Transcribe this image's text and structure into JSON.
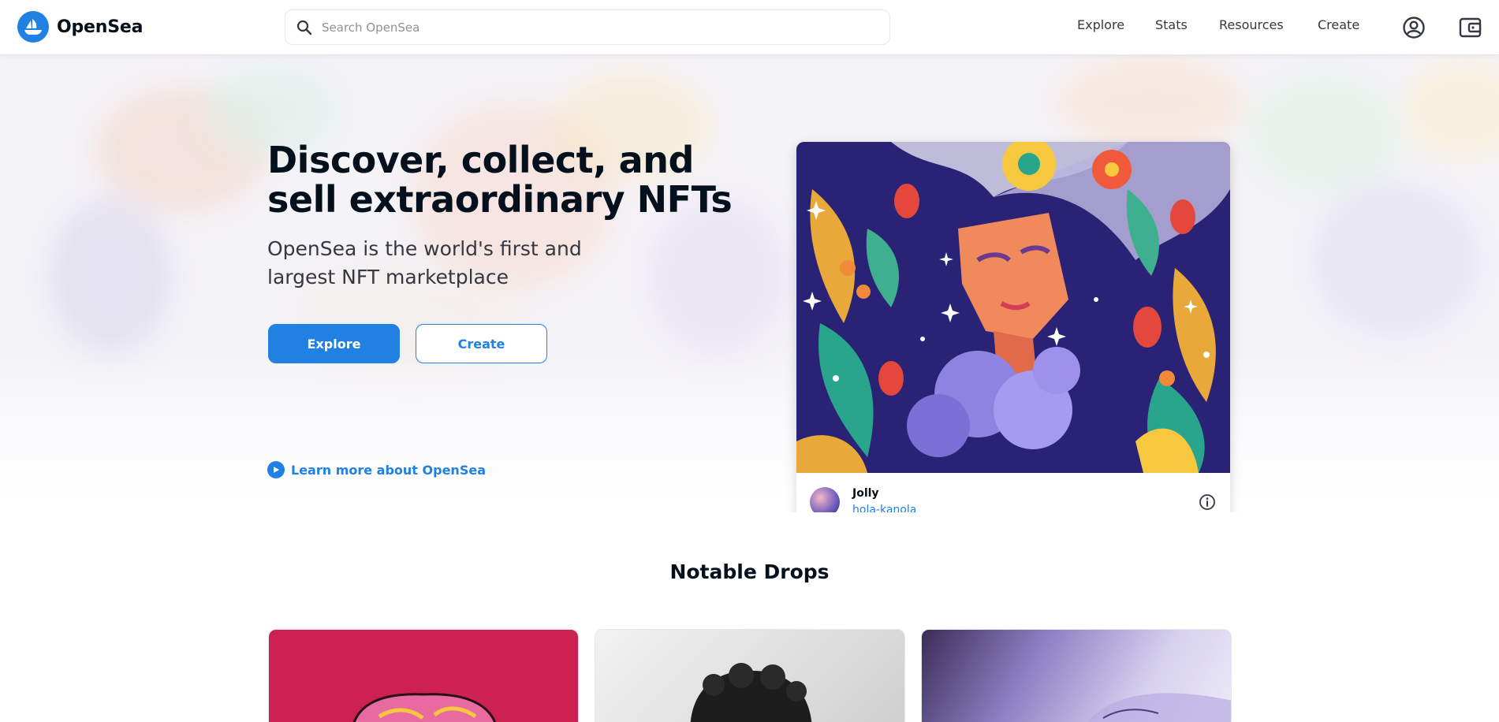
{
  "brand": {
    "name": "OpenSea",
    "accent": "#2081e2"
  },
  "search": {
    "placeholder": "Search OpenSea"
  },
  "nav": {
    "items": [
      {
        "label": "Explore"
      },
      {
        "label": "Stats"
      },
      {
        "label": "Resources"
      },
      {
        "label": "Create"
      }
    ],
    "icons": [
      "account-icon",
      "wallet-icon"
    ]
  },
  "hero": {
    "title": "Discover, collect, and sell extraordinary NFTs",
    "subtitle": "OpenSea is the world's first and largest NFT marketplace",
    "primary_button": "Explore",
    "secondary_button": "Create",
    "learn_more": "Learn more about OpenSea"
  },
  "featured": {
    "name": "Jolly",
    "creator": "hola-kanola"
  },
  "notable": {
    "title": "Notable Drops"
  }
}
